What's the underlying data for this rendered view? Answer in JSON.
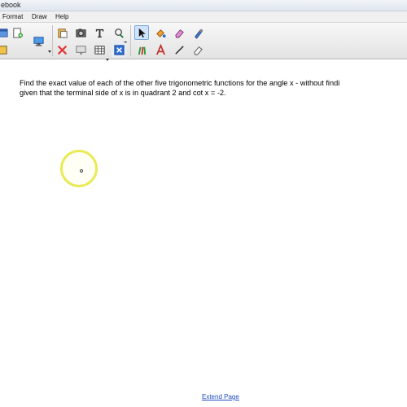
{
  "window": {
    "title": "ebook"
  },
  "menu": [
    "Format",
    "Draw",
    "Help"
  ],
  "toolbar": {
    "icons_row1": [
      "window-icon",
      "new-page-icon",
      "screen-capture-icon",
      "paste-icon",
      "camera-icon",
      "text-tool-icon",
      "lasso-icon",
      "select-arrow-icon",
      "fill-icon",
      "eraser-icon",
      "shape-recognition-pen-icon"
    ],
    "icons_row2": [
      "save-icon",
      "delete-icon",
      "screen-shade-icon",
      "table-icon",
      "full-screen-icon",
      "pens-icon",
      "text-icon",
      "line-icon",
      "highlighter-eraser-icon"
    ],
    "colors": {
      "select_active": "#cfe3fb",
      "delete_red": "#e03a3a",
      "accent_blue": "#2e6fd8"
    }
  },
  "canvas": {
    "question_line1": "Find the exact value of each of the other five trigonometric functions for the angle x - without findi",
    "question_line2": "given that the terminal side of x is in quadrant 2 and cot x = -2.",
    "extend_label": "Extend Page"
  }
}
